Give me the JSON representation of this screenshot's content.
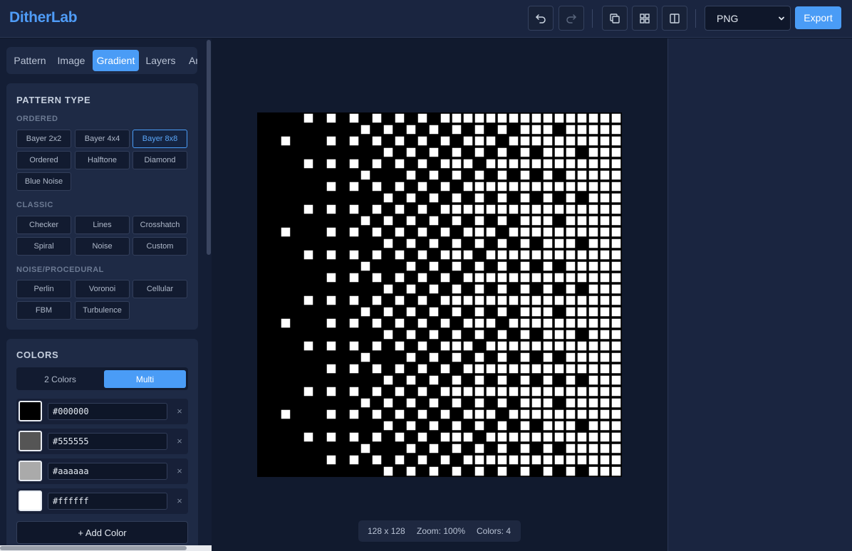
{
  "app": {
    "title": "DitherLab"
  },
  "toolbar": {
    "icons": [
      "undo-icon",
      "redo-icon",
      "duplicate-icon",
      "grid-icon",
      "split-view-icon"
    ],
    "format": "PNG",
    "export_label": "Export"
  },
  "tabs": [
    {
      "label": "Pattern",
      "active": false
    },
    {
      "label": "Image",
      "active": false
    },
    {
      "label": "Gradient",
      "active": true
    },
    {
      "label": "Layers",
      "active": false
    },
    {
      "label": "Animation",
      "active": false
    }
  ],
  "pattern_type": {
    "title": "PATTERN TYPE",
    "groups": [
      {
        "name": "ORDERED",
        "items": [
          "Bayer 2x2",
          "Bayer 4x4",
          "Bayer 8x8",
          "Ordered",
          "Halftone",
          "Diamond",
          "Blue Noise"
        ]
      },
      {
        "name": "CLASSIC",
        "items": [
          "Checker",
          "Lines",
          "Crosshatch",
          "Spiral",
          "Noise",
          "Custom"
        ]
      },
      {
        "name": "NOISE/PROCEDURAL",
        "items": [
          "Perlin",
          "Voronoi",
          "Cellular",
          "FBM",
          "Turbulence"
        ]
      }
    ],
    "selected": "Bayer 8x8"
  },
  "colors": {
    "title": "COLORS",
    "modes": [
      "2 Colors",
      "Multi"
    ],
    "active_mode": "Multi",
    "palette": [
      "#000000",
      "#555555",
      "#aaaaaa",
      "#ffffff"
    ],
    "remove_label": "×",
    "add_label": "+ Add Color"
  },
  "status": {
    "size": "128 x 128",
    "zoom": "Zoom: 100%",
    "colors": "Colors: 4"
  }
}
